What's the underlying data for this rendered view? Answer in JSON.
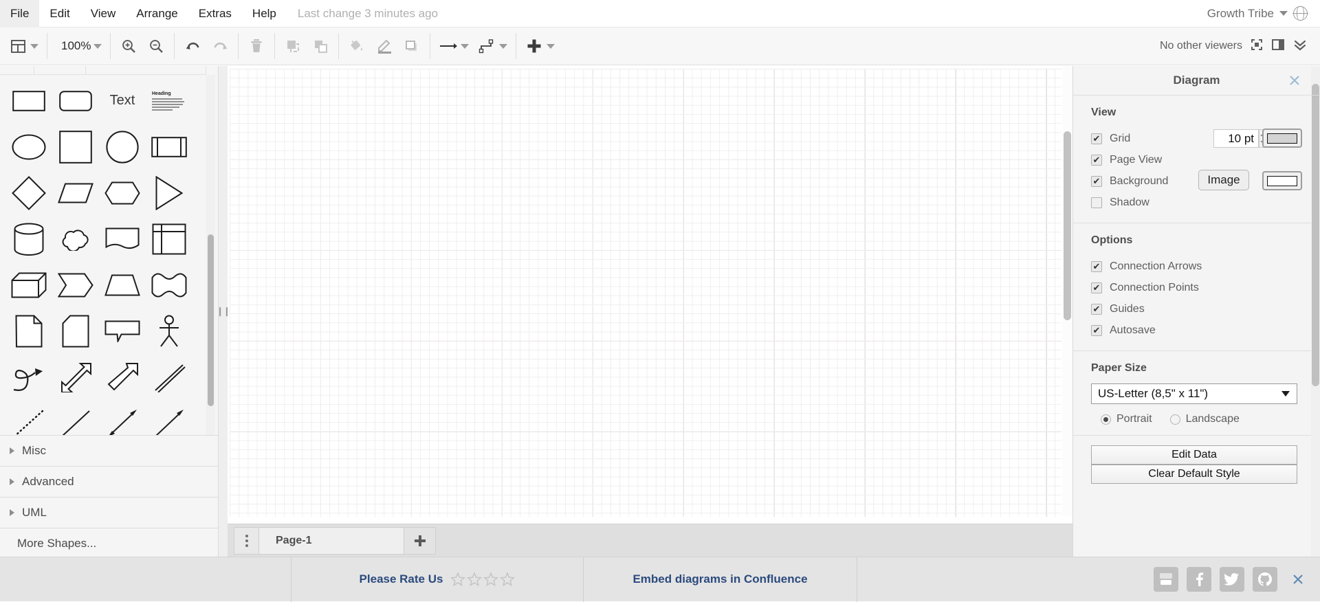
{
  "menubar": {
    "items": [
      {
        "label": "File",
        "name": "menu-file"
      },
      {
        "label": "Edit",
        "name": "menu-edit"
      },
      {
        "label": "View",
        "name": "menu-view"
      },
      {
        "label": "Arrange",
        "name": "menu-arrange"
      },
      {
        "label": "Extras",
        "name": "menu-extras"
      },
      {
        "label": "Help",
        "name": "menu-help"
      }
    ],
    "last_change": "Last change 3 minutes ago",
    "tribe": "Growth Tribe",
    "globe_icon": "globe-icon",
    "caret_icon": "chevron-down-icon"
  },
  "toolbar": {
    "view_layout_icon": "view-layout-icon",
    "zoom_level": "100%",
    "zoom_in_icon": "zoom-in-icon",
    "zoom_out_icon": "zoom-out-icon",
    "undo_icon": "undo-icon",
    "redo_icon": "redo-icon",
    "delete_icon": "trash-icon",
    "to_front_icon": "bring-to-front-icon",
    "to_back_icon": "send-to-back-icon",
    "fill_color_icon": "fill-color-icon",
    "line_color_icon": "line-color-icon",
    "shadow_icon": "shadow-icon",
    "waypoints_icon": "straight-connector-icon",
    "connection_icon": "orthogonal-connector-icon",
    "insert_icon": "plus-icon",
    "viewers_text": "No other viewers",
    "fullscreen_icon": "fullscreen-icon",
    "format_panel_icon": "format-panel-icon",
    "collapse_icon": "double-chevron-down-icon"
  },
  "shapes": {
    "rows": [
      [
        {
          "name": "shape-rectangle",
          "kind": "rect"
        },
        {
          "name": "shape-rounded-rectangle",
          "kind": "rounded-rect"
        },
        {
          "name": "shape-text",
          "kind": "text",
          "label": "Text"
        },
        {
          "name": "shape-textbox-heading",
          "kind": "textbox"
        }
      ],
      [
        {
          "name": "shape-ellipse",
          "kind": "ellipse"
        },
        {
          "name": "shape-square",
          "kind": "square"
        },
        {
          "name": "shape-circle",
          "kind": "circle"
        },
        {
          "name": "shape-process",
          "kind": "process"
        }
      ],
      [
        {
          "name": "shape-diamond",
          "kind": "diamond"
        },
        {
          "name": "shape-parallelogram",
          "kind": "parallelogram"
        },
        {
          "name": "shape-hexagon",
          "kind": "hexagon"
        },
        {
          "name": "shape-triangle",
          "kind": "triangle"
        }
      ],
      [
        {
          "name": "shape-cylinder",
          "kind": "cylinder"
        },
        {
          "name": "shape-cloud",
          "kind": "cloud"
        },
        {
          "name": "shape-document",
          "kind": "document"
        },
        {
          "name": "shape-internal-storage",
          "kind": "internal-storage"
        }
      ],
      [
        {
          "name": "shape-cube",
          "kind": "cube"
        },
        {
          "name": "shape-step",
          "kind": "step"
        },
        {
          "name": "shape-trapezoid",
          "kind": "trapezoid"
        },
        {
          "name": "shape-tape",
          "kind": "tape"
        }
      ],
      [
        {
          "name": "shape-note",
          "kind": "note"
        },
        {
          "name": "shape-card",
          "kind": "card"
        },
        {
          "name": "shape-callout",
          "kind": "callout"
        },
        {
          "name": "shape-actor",
          "kind": "actor"
        }
      ],
      [
        {
          "name": "shape-curved-arrow",
          "kind": "curved-arrow"
        },
        {
          "name": "shape-double-arrow",
          "kind": "double-block-arrow"
        },
        {
          "name": "shape-block-arrow",
          "kind": "block-arrow"
        },
        {
          "name": "shape-double-line",
          "kind": "double-line"
        }
      ],
      [
        {
          "name": "shape-dashed-line",
          "kind": "dashed-line"
        },
        {
          "name": "shape-plain-line",
          "kind": "plain-line"
        },
        {
          "name": "shape-bidirectional-arrow",
          "kind": "bidir-arrow"
        },
        {
          "name": "shape-directional-arrow",
          "kind": "dir-arrow"
        }
      ]
    ],
    "textbox_heading": "Heading",
    "sections": [
      {
        "label": "Misc",
        "name": "shape-section-misc"
      },
      {
        "label": "Advanced",
        "name": "shape-section-advanced"
      },
      {
        "label": "UML",
        "name": "shape-section-uml"
      }
    ],
    "more_shapes": "More Shapes..."
  },
  "tabbar": {
    "menu_icon": "page-menu-icon",
    "page_name": "Page-1",
    "add_icon": "add-page-icon"
  },
  "format_panel": {
    "title": "Diagram",
    "close_icon": "close-icon",
    "view": {
      "heading": "View",
      "grid_label": "Grid",
      "grid_size": "10 pt",
      "grid_color_swatch": "#cccccc",
      "page_view_label": "Page View",
      "background_label": "Background",
      "image_button": "Image",
      "background_color_swatch": "#ffffff",
      "shadow_label": "Shadow",
      "grid_checked": true,
      "page_view_checked": true,
      "background_checked": true,
      "shadow_checked": false
    },
    "options": {
      "heading": "Options",
      "items": [
        {
          "label": "Connection Arrows",
          "checked": true,
          "name": "option-connection-arrows"
        },
        {
          "label": "Connection Points",
          "checked": true,
          "name": "option-connection-points"
        },
        {
          "label": "Guides",
          "checked": true,
          "name": "option-guides"
        },
        {
          "label": "Autosave",
          "checked": true,
          "name": "option-autosave"
        }
      ]
    },
    "paper": {
      "heading": "Paper Size",
      "selected": "US-Letter (8,5\" x 11\")",
      "orientation": [
        {
          "label": "Portrait",
          "selected": true,
          "name": "radio-portrait"
        },
        {
          "label": "Landscape",
          "selected": false,
          "name": "radio-landscape"
        }
      ]
    },
    "actions": {
      "edit_data": "Edit Data",
      "clear_default_style": "Clear Default Style"
    }
  },
  "footer": {
    "rate_us": "Please Rate Us",
    "star_count": 4,
    "embed": "Embed diagrams in Confluence",
    "socials": [
      {
        "name": "youtube-icon",
        "label": "YouTube"
      },
      {
        "name": "facebook-icon",
        "label": "Facebook"
      },
      {
        "name": "twitter-icon",
        "label": "Twitter"
      },
      {
        "name": "github-icon",
        "label": "GitHub"
      }
    ],
    "close_icon": "close-icon"
  },
  "colors": {
    "link_blue": "#2b4a7d",
    "panel_bg": "#f4f4f4",
    "toolbar_bg": "#f7f7f7",
    "footer_bg": "#e4e4e4"
  }
}
